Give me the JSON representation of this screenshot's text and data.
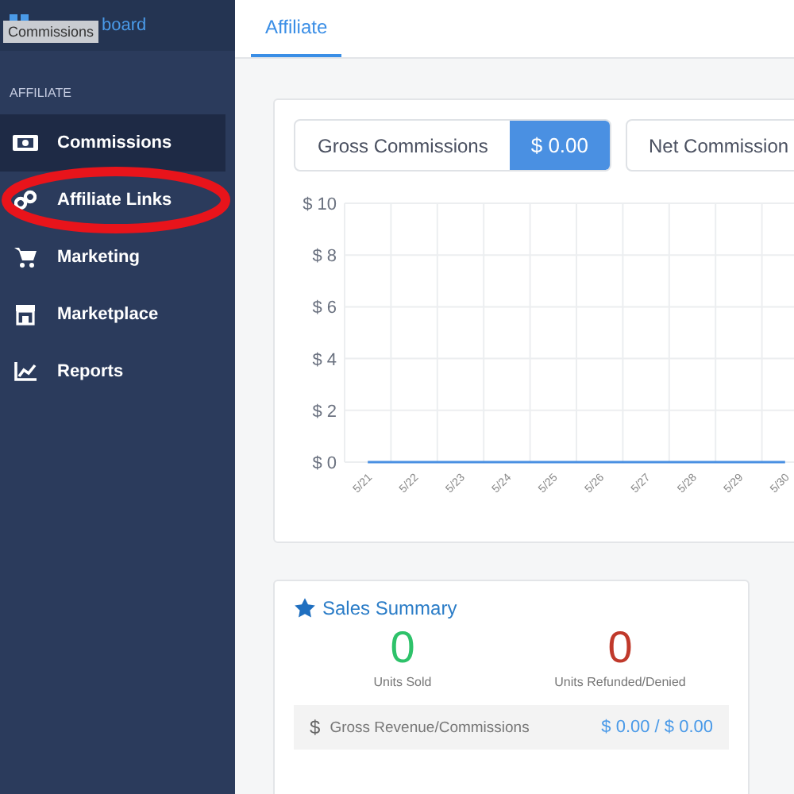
{
  "sidebar": {
    "top_link": {
      "text": "board"
    },
    "tooltip": "Commissions",
    "section": "AFFILIATE",
    "items": [
      {
        "label": "Commissions",
        "selected": true
      },
      {
        "label": "Affiliate Links",
        "selected": false,
        "circled": true
      },
      {
        "label": "Marketing",
        "selected": false
      },
      {
        "label": "Marketplace",
        "selected": false
      },
      {
        "label": "Reports",
        "selected": false
      }
    ]
  },
  "header": {
    "tabs": [
      {
        "label": "Affiliate",
        "selected": true
      }
    ]
  },
  "commissions_card": {
    "toggles": [
      {
        "label": "Gross Commissions",
        "value": "$ 0.00"
      },
      {
        "label": "Net Commission"
      }
    ],
    "chart_data": {
      "type": "line",
      "categories": [
        "5/21",
        "5/22",
        "5/23",
        "5/24",
        "5/25",
        "5/26",
        "5/27",
        "5/28",
        "5/29",
        "5/30"
      ],
      "series": [
        {
          "color": "#4a90e2",
          "values": [
            0,
            0,
            0,
            0,
            0,
            0,
            0,
            0,
            0,
            0
          ]
        }
      ],
      "grid": true,
      "ylim": [
        0,
        10
      ],
      "yticks": [
        {
          "value": 0,
          "label": "$ 0"
        },
        {
          "value": 2,
          "label": "$ 2"
        },
        {
          "value": 4,
          "label": "$ 4"
        },
        {
          "value": 6,
          "label": "$ 6"
        },
        {
          "value": 8,
          "label": "$ 8"
        },
        {
          "value": 10,
          "label": "$ 10"
        }
      ]
    }
  },
  "sales_summary": {
    "title": "Sales Summary",
    "stats": [
      {
        "value": "0",
        "label": "Units Sold",
        "color": "#2ec26a"
      },
      {
        "value": "0",
        "label": "Units Refunded/Denied",
        "color": "#c0392b"
      }
    ],
    "rows": [
      {
        "icon": "$",
        "label": "Gross Revenue/Commissions",
        "value": "$ 0.00 / $ 0.00"
      }
    ]
  }
}
